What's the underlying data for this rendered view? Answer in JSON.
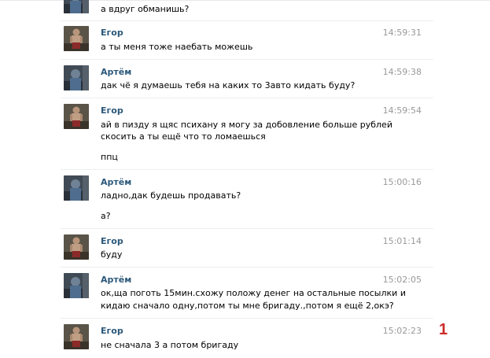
{
  "messages": [
    {
      "author": "",
      "avatar": "artyom-photo-icon",
      "time": "",
      "lines": [
        "а вдруг обманишь?"
      ]
    },
    {
      "author": "Егор",
      "avatar": "egor-photo-icon",
      "time": "14:59:31",
      "lines": [
        "а ты меня тоже наебать можешь"
      ]
    },
    {
      "author": "Артём",
      "avatar": "artyom-photo-icon",
      "time": "14:59:38",
      "lines": [
        "дак чё я думаешь тебя на каких то 3авто кидать буду?"
      ]
    },
    {
      "author": "Егор",
      "avatar": "egor-photo-icon",
      "time": "14:59:54",
      "lines": [
        "ай в пизду я щяс психану я могу за добовление больше рублей",
        "скосить а ты ещё что то ломаешься",
        "ппц"
      ]
    },
    {
      "author": "Артём",
      "avatar": "artyom-photo-icon",
      "time": "15:00:16",
      "lines": [
        "ладно,дак будешь продавать?",
        "а?"
      ]
    },
    {
      "author": "Егор",
      "avatar": "egor-photo-icon",
      "time": "15:01:14",
      "lines": [
        "буду"
      ]
    },
    {
      "author": "Артём",
      "avatar": "artyom-photo-icon",
      "time": "15:02:05",
      "lines": [
        "ок,ща поготь 15мин.схожу положу денег на остальные посылки и",
        "кидаю сначало одну,потом ты мне бригаду.,потом я ещё 2,окэ?"
      ]
    },
    {
      "author": "Егор",
      "avatar": "egor-photo-icon",
      "time": "15:02:23",
      "lines": [
        "не сначала 3 а потом бригаду"
      ]
    }
  ],
  "marker": "1",
  "colors": {
    "author": "#2b587a",
    "time": "#999999",
    "marker": "#cc2a2a"
  }
}
